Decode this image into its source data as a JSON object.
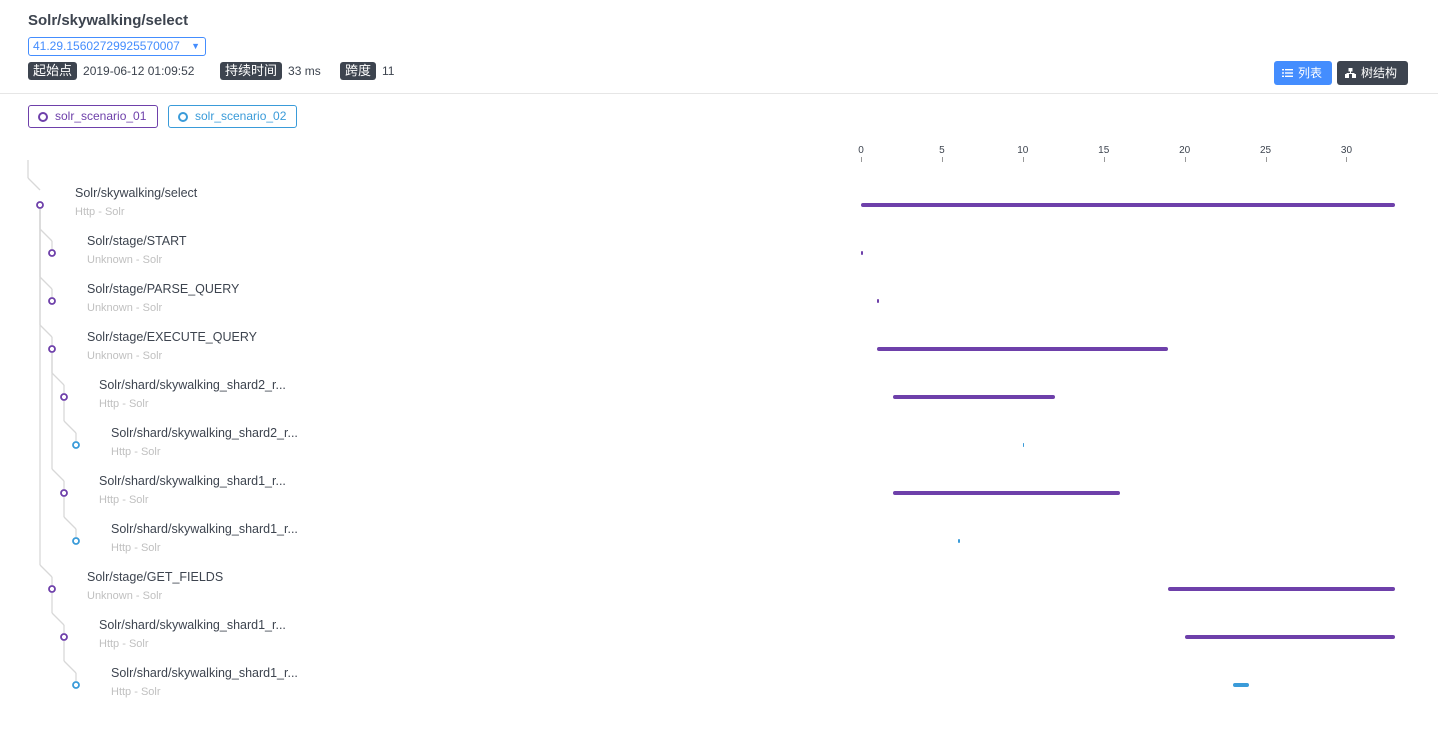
{
  "header": {
    "title": "Solr/skywalking/select",
    "trace_id": "41.29.15602729925570007",
    "start_label": "起始点",
    "start_value": "2019-06-12 01:09:52",
    "duration_label": "持续时间",
    "duration_value": "33 ms",
    "span_label": "跨度",
    "span_value": "11",
    "btn_list": "列表",
    "btn_tree": "树结构"
  },
  "legend": [
    {
      "label": "solr_scenario_01",
      "color": "#6e40aa"
    },
    {
      "label": "solr_scenario_02",
      "color": "#3a9bd9"
    }
  ],
  "axis": {
    "min": 0,
    "max": 33,
    "ticks": [
      "0",
      "5",
      "10",
      "15",
      "20",
      "25",
      "30"
    ]
  },
  "spans": [
    {
      "name": "Solr/skywalking/select",
      "sub": "Http - Solr",
      "depth": 0,
      "service": 0,
      "start": 0,
      "end": 33
    },
    {
      "name": "Solr/stage/START",
      "sub": "Unknown - Solr",
      "depth": 1,
      "service": 0,
      "start": 0,
      "end": 0.05
    },
    {
      "name": "Solr/stage/PARSE_QUERY",
      "sub": "Unknown - Solr",
      "depth": 1,
      "service": 0,
      "start": 1,
      "end": 1.05
    },
    {
      "name": "Solr/stage/EXECUTE_QUERY",
      "sub": "Unknown - Solr",
      "depth": 1,
      "service": 0,
      "start": 1,
      "end": 19
    },
    {
      "name": "Solr/shard/skywalking_shard2_r...",
      "sub": "Http - Solr",
      "depth": 2,
      "service": 0,
      "start": 2,
      "end": 12
    },
    {
      "name": "Solr/shard/skywalking_shard2_r...",
      "sub": "Http - Solr",
      "depth": 3,
      "service": 1,
      "start": 10,
      "end": 10.05
    },
    {
      "name": "Solr/shard/skywalking_shard1_r...",
      "sub": "Http - Solr",
      "depth": 2,
      "service": 0,
      "start": 2,
      "end": 16
    },
    {
      "name": "Solr/shard/skywalking_shard1_r...",
      "sub": "Http - Solr",
      "depth": 3,
      "service": 1,
      "start": 6,
      "end": 6.05
    },
    {
      "name": "Solr/stage/GET_FIELDS",
      "sub": "Unknown - Solr",
      "depth": 1,
      "service": 0,
      "start": 19,
      "end": 33
    },
    {
      "name": "Solr/shard/skywalking_shard1_r...",
      "sub": "Http - Solr",
      "depth": 2,
      "service": 0,
      "start": 20,
      "end": 33
    },
    {
      "name": "Solr/shard/skywalking_shard1_r...",
      "sub": "Http - Solr",
      "depth": 3,
      "service": 1,
      "start": 23,
      "end": 24
    }
  ]
}
